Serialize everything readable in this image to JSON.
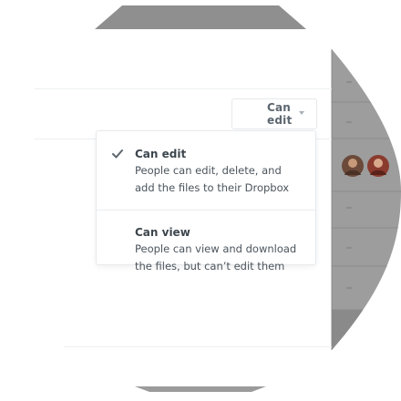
{
  "permission_dropdown": {
    "selected_label": "Can edit",
    "icon": "chevron-down-icon"
  },
  "menu": {
    "options": [
      {
        "title": "Can edit",
        "description": "People can edit, delete, and\nadd the files to their Dropbox",
        "selected": true,
        "icon": "checkmark-icon"
      },
      {
        "title": "Can view",
        "description": "People can view and download\nthe files, but can’t edit them",
        "selected": false
      }
    ]
  },
  "colors": {
    "accent_navy": "#1f3a4d",
    "panel_gray": "#9a9a9a",
    "border": "#e7eaed",
    "text": "#3d464d"
  }
}
